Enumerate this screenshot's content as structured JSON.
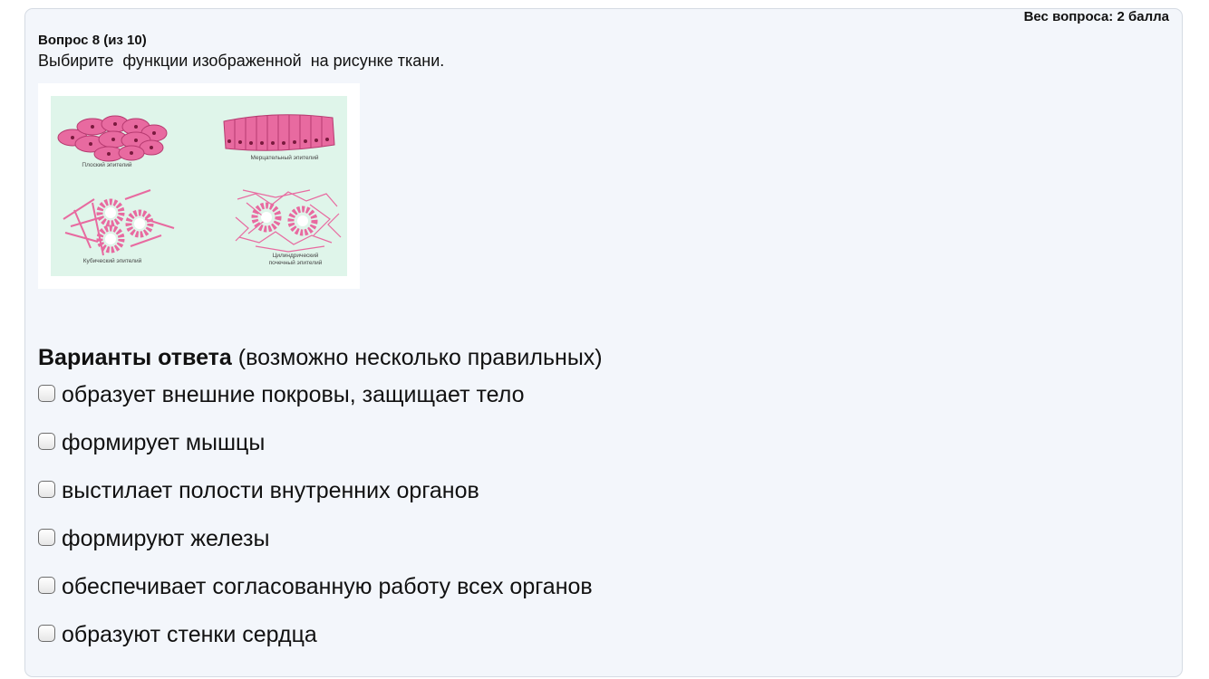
{
  "question": {
    "weight_label": "Вес вопроса: 2 балла",
    "number_label": "Вопрос 8 (из 10)",
    "text": "Выбирите  функции изображенной  на рисунке ткани."
  },
  "figure": {
    "captions": {
      "flat": "Плоский эпителий",
      "ciliated": "Мерцательный эпителий",
      "cubic": "Кубический эпителий",
      "cylindrical_line1": "Цилиндрический",
      "cylindrical_line2": "почечный эпителий"
    },
    "colors": {
      "background": "#dff5ea",
      "cell": "#e86aa0",
      "nucleus": "#7a1a3e"
    }
  },
  "answers": {
    "heading_bold": "Варианты ответа",
    "heading_rest": " (возможно несколько правильных)",
    "options": [
      {
        "label": "образует внешние покровы, защищает тело",
        "checked": false
      },
      {
        "label": "формирует мышцы",
        "checked": false
      },
      {
        "label": "выстилает полости внутренних органов",
        "checked": false
      },
      {
        "label": "формируют железы",
        "checked": false
      },
      {
        "label": "обеспечивает согласованную работу всех органов",
        "checked": false
      },
      {
        "label": "образуют стенки сердца",
        "checked": false
      }
    ]
  }
}
